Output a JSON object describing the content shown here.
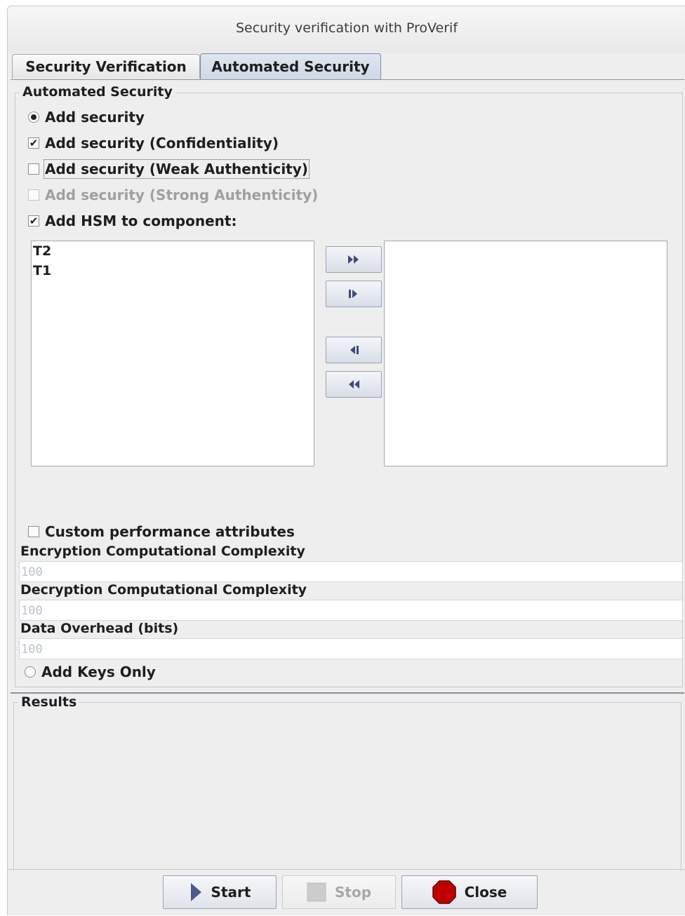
{
  "window": {
    "title": "Security verification with ProVerif"
  },
  "tabs": [
    {
      "label": "Security Verification",
      "active": false
    },
    {
      "label": "Automated Security",
      "active": true
    }
  ],
  "automated": {
    "group_title": "Automated Security",
    "add_security": {
      "label": "Add security",
      "selected": true
    },
    "confidentiality": {
      "label": "Add security (Confidentiality)",
      "checked": true
    },
    "weak_auth": {
      "label": "Add security (Weak Authenticity)",
      "checked": false
    },
    "strong_auth": {
      "label": "Add security (Strong Authenticity)",
      "checked": false,
      "enabled": false
    },
    "hsm": {
      "label": "Add HSM to component:",
      "checked": true
    },
    "available_components": [
      "T2",
      "T1"
    ],
    "selected_components": [],
    "move_buttons": [
      "move-all-right-icon",
      "move-right-icon",
      "move-left-icon",
      "move-all-left-icon"
    ],
    "custom_perf": {
      "label": "Custom performance attributes",
      "checked": false
    },
    "encryption": {
      "label": "Encryption Computational Complexity",
      "value": "100"
    },
    "decryption": {
      "label": "Decryption Computational Complexity",
      "value": "100"
    },
    "overhead": {
      "label": "Data Overhead (bits)",
      "value": "100"
    },
    "keys_only": {
      "label": "Add Keys Only",
      "selected": false
    }
  },
  "results": {
    "title": "Results"
  },
  "buttons": {
    "start": {
      "label": "Start",
      "icon": "play-icon"
    },
    "stop": {
      "label": "Stop",
      "icon": "stop-square-icon",
      "enabled": false
    },
    "close": {
      "label": "Close",
      "icon": "stop-sign-icon"
    }
  },
  "colors": {
    "accent": "#4a5a8c",
    "close_red": "#c00000",
    "tab_active": "#d5dcea"
  }
}
